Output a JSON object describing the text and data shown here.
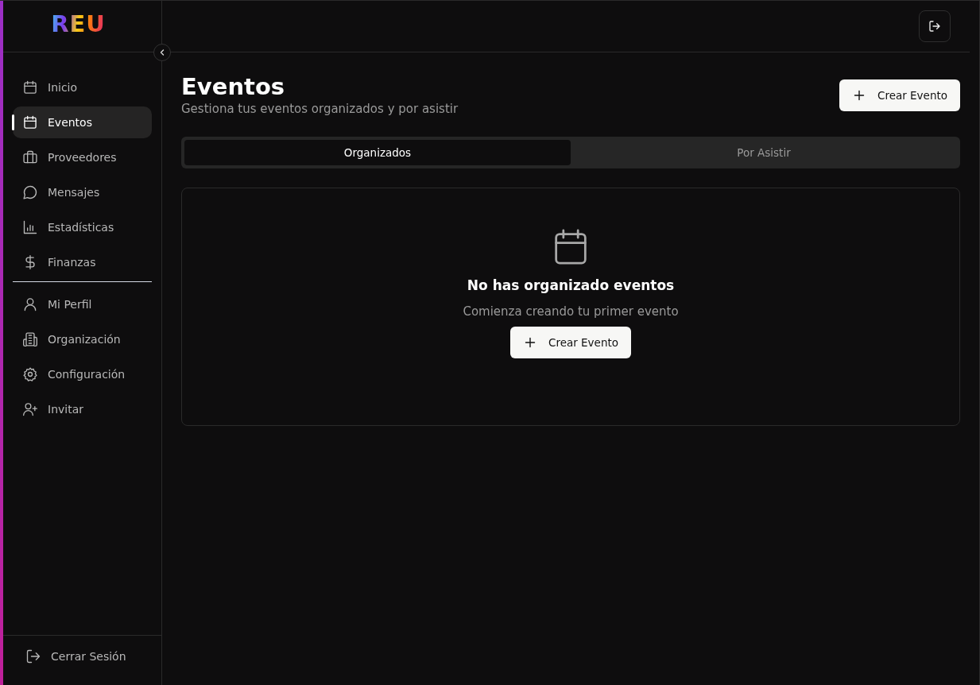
{
  "logo": "REU",
  "nav_main": [
    {
      "label": "Inicio",
      "selected": false
    },
    {
      "label": "Eventos",
      "selected": true
    },
    {
      "label": "Proveedores",
      "selected": false
    },
    {
      "label": "Mensajes",
      "selected": false
    },
    {
      "label": "Estadísticas",
      "selected": false
    },
    {
      "label": "Finanzas",
      "selected": false
    }
  ],
  "nav_secondary": [
    {
      "label": "Mi Perfil",
      "selected": false
    },
    {
      "label": "Organización",
      "selected": false
    },
    {
      "label": "Configuración",
      "selected": false
    },
    {
      "label": "Invitar",
      "selected": false
    }
  ],
  "logout": "Cerrar Sesión",
  "page": {
    "title": "Eventos",
    "subtitle": "Gestiona tus eventos organizados y por asistir",
    "create_button": "Crear Evento"
  },
  "tabs": [
    {
      "label": "Organizados",
      "selected": true
    },
    {
      "label": "Por Asistir",
      "selected": false
    }
  ],
  "empty_state": {
    "title": "No has organizado eventos",
    "message": "Comienza creando tu primer evento",
    "button": "Crear Evento"
  }
}
